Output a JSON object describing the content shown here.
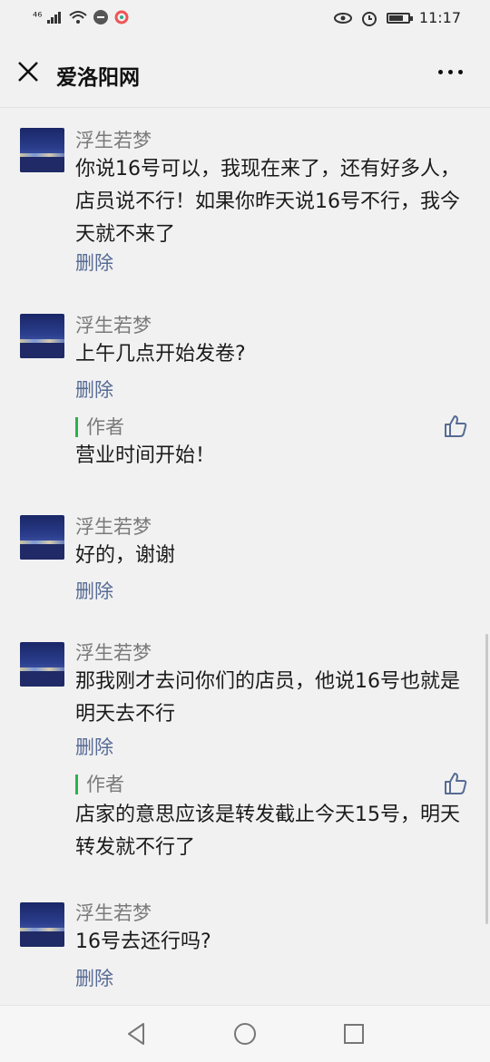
{
  "status_bar": {
    "signal_label": "⁴⁶",
    "time": "11:17"
  },
  "header": {
    "title": "爱洛阳网"
  },
  "comments": [
    {
      "nick": "浮生若梦",
      "text": "你说16号可以，我现在来了，还有好多人，店员说不行！如果你昨天说16号不行，我今天就不来了",
      "delete_label": "删除"
    },
    {
      "nick": "浮生若梦",
      "text": "上午几点开始发卷?",
      "delete_label": "删除",
      "reply": {
        "label": "作者",
        "text": "营业时间开始！"
      }
    },
    {
      "nick": "浮生若梦",
      "text": "好的，谢谢",
      "delete_label": "删除"
    },
    {
      "nick": "浮生若梦",
      "text": "那我刚才去问你们的店员，他说16号也就是明天去不行",
      "delete_label": "删除",
      "reply": {
        "label": "作者",
        "text": "店家的意思应该是转发截止今天15号，明天转发就不行了"
      }
    },
    {
      "nick": "浮生若梦",
      "text": "16号去还行吗?",
      "delete_label": "删除"
    }
  ],
  "icons": {
    "close": "close-icon",
    "more": "more-icon",
    "like": "thumbs-up-icon",
    "back": "back-triangle-icon",
    "home": "home-circle-icon",
    "recent": "recent-square-icon"
  },
  "colors": {
    "link": "#576b95",
    "accent": "#2bb24c"
  }
}
